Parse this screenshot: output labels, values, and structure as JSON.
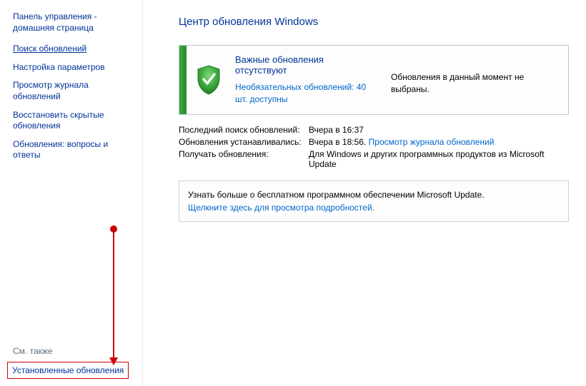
{
  "sidebar": {
    "home": "Панель управления - домашняя страница",
    "links": [
      {
        "label": "Поиск обновлений",
        "underline": true
      },
      {
        "label": "Настройка параметров",
        "underline": false
      },
      {
        "label": "Просмотр журнала обновлений",
        "underline": false
      },
      {
        "label": "Восстановить скрытые обновления",
        "underline": false
      },
      {
        "label": "Обновления: вопросы и ответы",
        "underline": false
      }
    ],
    "see_also": "См. также",
    "installed_updates": "Установленные обновления"
  },
  "main": {
    "title": "Центр обновления Windows",
    "status": {
      "heading": "Важные обновления отсутствуют",
      "optional_link": "Необязательных обновлений: 40 шт. доступны",
      "selected_text": "Обновления в данный момент не выбраны."
    },
    "info": {
      "row1_label": "Последний поиск обновлений:",
      "row1_value": "Вчера в 16:37",
      "row2_label": "Обновления устанавливались:",
      "row2_value": "Вчера в 18:56.",
      "row2_link": "Просмотр журнала обновлений",
      "row3_label": "Получать обновления:",
      "row3_value": "Для Windows и других программных продуктов из Microsoft Update"
    },
    "learn_more": {
      "text": "Узнать больше о бесплатном программном обеспечении Microsoft Update.",
      "link": "Щелкните здесь для просмотра подробностей."
    }
  }
}
